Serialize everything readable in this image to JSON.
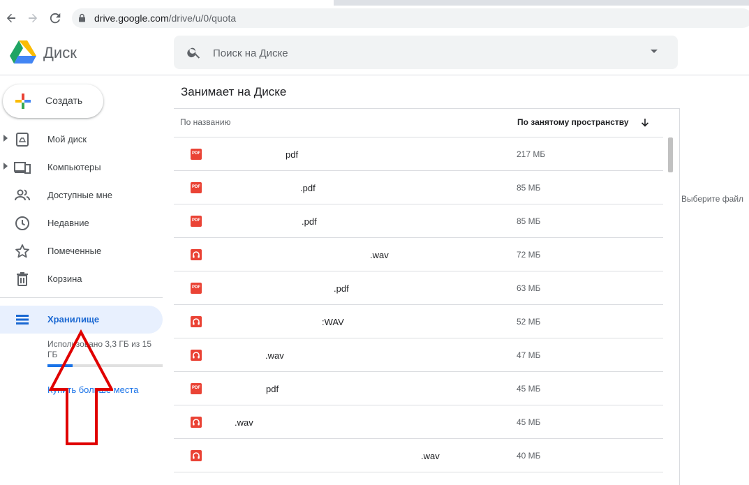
{
  "browser": {
    "url_host": "drive.google.com",
    "url_path": "/drive/u/0/quota"
  },
  "app": {
    "name": "Диск",
    "search_placeholder": "Поиск на Диске",
    "create_label": "Создать"
  },
  "sidebar": {
    "items": [
      {
        "label": "Мой диск",
        "icon": "my-drive-icon"
      },
      {
        "label": "Компьютеры",
        "icon": "computers-icon"
      },
      {
        "label": "Доступные мне",
        "icon": "shared-icon"
      },
      {
        "label": "Недавние",
        "icon": "recent-clock-icon"
      },
      {
        "label": "Помеченные",
        "icon": "star-icon"
      },
      {
        "label": "Корзина",
        "icon": "trash-icon"
      }
    ],
    "storage": {
      "label": "Хранилище",
      "usage_text": "Использовано 3,3 ГБ из 15 ГБ",
      "usage_fraction": 0.22,
      "buy_link": "Купить больше места"
    }
  },
  "main": {
    "title": "Занимает на Диске",
    "col_name": "По названию",
    "col_size": "По занятому пространству",
    "details_hint": "Выберите файл",
    "files": [
      {
        "type": "pdf",
        "name": "pdf",
        "size": "217 МБ"
      },
      {
        "type": "pdf",
        "name": ".pdf",
        "size": "85 МБ"
      },
      {
        "type": "pdf",
        "name": ".pdf",
        "size": "85 МБ"
      },
      {
        "type": "audio",
        "name": ".wav",
        "size": "72 МБ"
      },
      {
        "type": "pdf",
        "name": ".pdf",
        "size": "63 МБ"
      },
      {
        "type": "audio",
        "name": ":WAV",
        "size": "52 МБ"
      },
      {
        "type": "audio",
        "name": ".wav",
        "size": "47 МБ"
      },
      {
        "type": "pdf",
        "name": "pdf",
        "size": "45 МБ"
      },
      {
        "type": "audio",
        "name": ".wav",
        "size": "45 МБ"
      },
      {
        "type": "audio",
        "name": ".wav",
        "size": "40 МБ"
      }
    ]
  },
  "colors": {
    "accent": "#1a73e8",
    "active_bg": "#e8f0fe",
    "file_red": "#ea4335",
    "annotation_arrow": "#e00000"
  }
}
